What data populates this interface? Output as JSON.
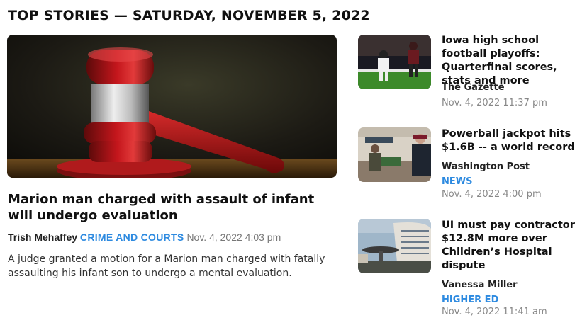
{
  "header": {
    "title": "TOP STORIES — SATURDAY, NOVEMBER 5, 2022"
  },
  "main_story": {
    "image": "gavel-image",
    "title": "Marion man charged with assault of infant will undergo evaluation",
    "author": "Trish Mehaffey",
    "tag": "CRIME AND COURTS",
    "date": "Nov. 4, 2022 4:03 pm",
    "summary": "A judge granted a motion for a Marion man charged with fatally assaulting his infant son to undergo a mental evaluation."
  },
  "side_stories": [
    {
      "image": "football-image",
      "title": "Iowa high school football playoffs: Quarterfinal scores, stats and more",
      "source": "The Gazette",
      "tag": "",
      "date": "Nov. 4, 2022 11:37 pm"
    },
    {
      "image": "powerball-image",
      "title": "Powerball jackpot hits $1.6B -- a world record",
      "source": "Washington Post",
      "tag": "NEWS",
      "date": "Nov. 4, 2022 4:00 pm"
    },
    {
      "image": "hospital-image",
      "title": "UI must pay contractor $12.8M more over Children’s Hospital dispute",
      "source": "Vanessa Miller",
      "tag": "HIGHER ED",
      "date": "Nov. 4, 2022 11:41 am"
    }
  ],
  "colors": {
    "accent": "#2d8ae0",
    "text": "#111111",
    "muted": "#888888"
  }
}
